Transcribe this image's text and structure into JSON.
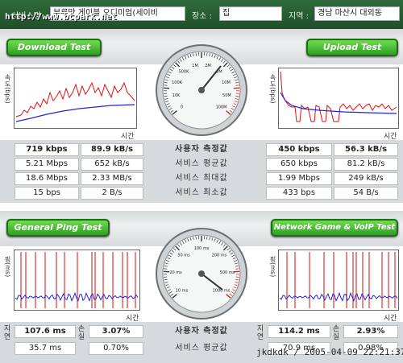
{
  "top_bar": {
    "server_label": "서비스명",
    "server_value": "부루맛 게이블 오디미엄(세이비",
    "place_label": "장소 :",
    "place_value": "집",
    "region_label": "지역 :",
    "region_value": "경남 마산시 대외동",
    "watermark": "http://www.bcpark.net"
  },
  "download": {
    "button": "Download Test",
    "y_label": "속도(bps)",
    "x_label": "시간"
  },
  "upload": {
    "button": "Upload Test",
    "y_label": "속도(bps)",
    "x_label": "시간"
  },
  "ping": {
    "button": "General Ping Test",
    "y_label": "핑(ms)",
    "x_label": "시간"
  },
  "network": {
    "button": "Network Game & VoIP Test",
    "y_label": "핑(ms)",
    "x_label": "시간"
  },
  "speed_gauge_ticks": [
    "0",
    "10K",
    "100K",
    "500K",
    "1M",
    "2M",
    "5M",
    "10M",
    "50M",
    "100M"
  ],
  "ping_gauge_ticks": [
    "10 ms",
    "20 ms",
    "50 ms",
    "100 ms",
    "200 ms",
    "500 ms",
    "1000 ms"
  ],
  "speed_rows": {
    "labels": [
      "사용자 측정값",
      "서비스 평균값",
      "서비스 최대값",
      "서비스 최소값"
    ],
    "download": [
      [
        "719 kbps",
        "89.9 kB/s"
      ],
      [
        "5.21 Mbps",
        "652 kB/s"
      ],
      [
        "18.6 Mbps",
        "2.33 MB/s"
      ],
      [
        "15 bps",
        "2 B/s"
      ]
    ],
    "upload": [
      [
        "450 kbps",
        "56.3 kB/s"
      ],
      [
        "650 kbps",
        "81.2 kB/s"
      ],
      [
        "1.99 Mbps",
        "249 kB/s"
      ],
      [
        "433 bps",
        "54 B/s"
      ]
    ]
  },
  "ping_rows": {
    "labels": [
      "사용자 측정값",
      "서비스 평균값"
    ],
    "left_side_label": "지연",
    "loss_label": "손실",
    "ping": [
      [
        "107.6 ms",
        "3.07%"
      ],
      [
        "35.7 ms",
        "0.70%"
      ]
    ],
    "network": [
      [
        "114.2 ms",
        "2.93%"
      ],
      [
        "70.9 ms",
        "0.98%"
      ]
    ]
  },
  "footer": "jkdkdk / 2005-04-09 22:21:37",
  "colors": {
    "band_green": "#2e9e24",
    "series_red": "#d11",
    "series_blue": "#22d"
  }
}
